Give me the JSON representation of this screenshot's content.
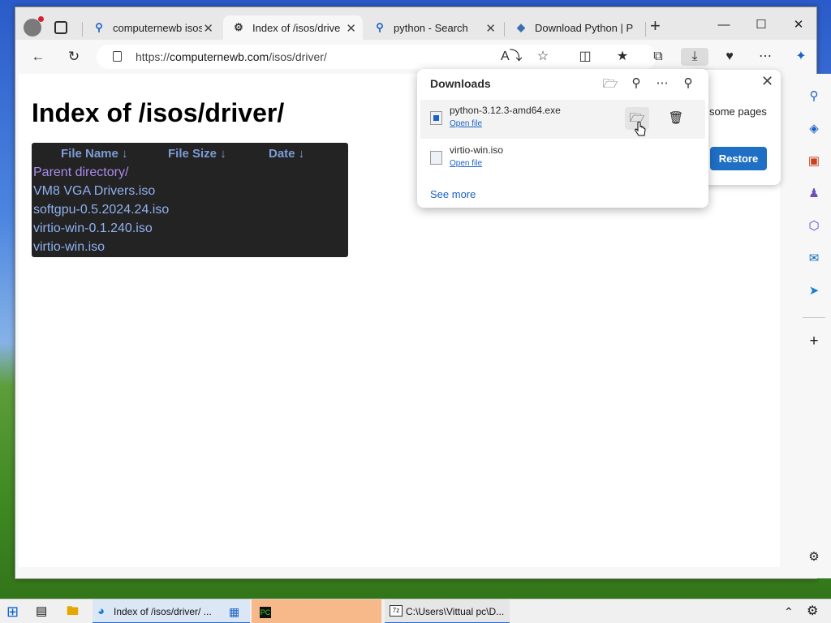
{
  "browser": {
    "tabs": [
      {
        "label": "computernewb isos",
        "icon": "search-icon",
        "active": false
      },
      {
        "label": "Index of /isos/driver/",
        "icon": "site-icon",
        "active": true
      },
      {
        "label": "python - Search",
        "icon": "search-icon",
        "active": false
      },
      {
        "label": "Download Python | P",
        "icon": "python-icon",
        "active": false
      }
    ],
    "address": {
      "scheme": "https://",
      "host": "computernewb.com",
      "path": "/isos/driver/"
    },
    "window_controls": {
      "minimize": "—",
      "maximize": "☐",
      "close": "✕"
    }
  },
  "page": {
    "title": "Index of /isos/driver/",
    "columns": [
      "File Name ↓",
      "File Size ↓",
      "Date ↓"
    ],
    "rows": [
      {
        "name": "Parent directory/",
        "size": "",
        "date": ""
      },
      {
        "name": "VM8 VGA Drivers.iso",
        "size": "",
        "date": ""
      },
      {
        "name": "softgpu-0.5.2024.24.iso",
        "size": "",
        "date": ""
      },
      {
        "name": "virtio-win-0.1.240.iso",
        "size": "",
        "date": ""
      },
      {
        "name": "virtio-win.iso",
        "size": "",
        "date": ""
      }
    ]
  },
  "downloads": {
    "title": "Downloads",
    "items": [
      {
        "filename": "python-3.12.3-amd64.exe",
        "action": "Open file"
      },
      {
        "filename": "virtio-win.iso",
        "action": "Open file"
      }
    ],
    "see_more": "See more"
  },
  "restore_panel": {
    "text": "some pages",
    "button": "Restore"
  },
  "taskbar": {
    "edge_label": "Index of /isos/driver/ ...",
    "cmd_label": "C:\\Users\\Vittual pc\\D..."
  },
  "colors": {
    "accent": "#1f6fc5",
    "link": "#1a62c5",
    "table_bg": "#232323",
    "table_header": "#7d9bd6"
  }
}
